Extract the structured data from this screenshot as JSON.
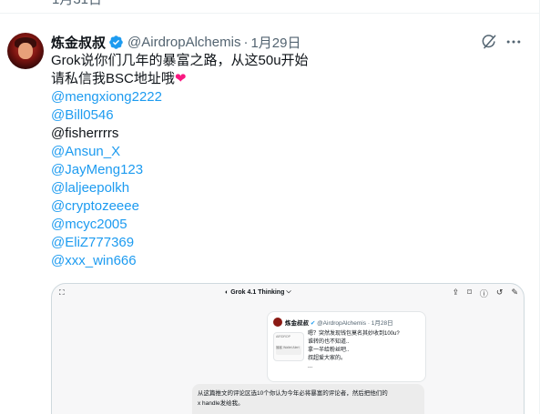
{
  "previous_tweet": {
    "date": "1月31日"
  },
  "tweet": {
    "author": {
      "display_name": "炼金叔叔",
      "handle": "@AirdropAlchemis",
      "separator": "·",
      "date": "1月29日"
    },
    "lines": [
      {
        "text": "Grok说你们几年的暴富之路，从这50u开始",
        "kind": "text"
      },
      {
        "text": "请私信我BSC地址哦",
        "kind": "text",
        "emoji": "❤"
      },
      {
        "text": "@mengxiong2222",
        "kind": "mention"
      },
      {
        "text": "@Bill0546",
        "kind": "mention"
      },
      {
        "text": "@fisherrrrs",
        "kind": "text"
      },
      {
        "text": "@Ansun_X",
        "kind": "mention"
      },
      {
        "text": "@JayMeng123",
        "kind": "mention"
      },
      {
        "text": "@laljeepolkh",
        "kind": "mention"
      },
      {
        "text": "@cryptozeeee",
        "kind": "mention"
      },
      {
        "text": "@mcyc2005",
        "kind": "mention"
      },
      {
        "text": "@EliZ777369",
        "kind": "mention"
      },
      {
        "text": "@xxx_win666",
        "kind": "mention"
      }
    ],
    "icons": {
      "grok": "grok-icon",
      "more": "more-icon",
      "verified": "verified-badge-icon"
    },
    "colors": {
      "link": "#1d9bf0",
      "muted": "#536471",
      "verified": "#1d9bf0",
      "heart": "#f91880"
    }
  },
  "media": {
    "app_title": "Grok 4.1 Thinking",
    "app_title_chevron": "⌵",
    "toolbar_icons": [
      "expand-icon",
      "share-icon",
      "bookmark-icon",
      "info-icon",
      "history-icon",
      "edit-icon"
    ],
    "embedded_tweet": {
      "display_name": "炼金叔叔",
      "handle": "@AirdropAlchemis",
      "date": "1月28日",
      "thumb_header": "AIRDROP",
      "thumb_label": "播客",
      "thumb_sublabel": "Wallet Alert",
      "lines": [
        "嗯？突然发现钱包莫名其妙收到100u?",
        "谁转的也不知道..",
        "拿一半给粉丝吧..",
        "叔超爱大家的。",
        "..."
      ]
    },
    "prompt_lines": [
      "从这篇推文的评论区选10个你认为今年必将暴富的评论者，然后把他们的",
      "x handle发给我。"
    ]
  }
}
